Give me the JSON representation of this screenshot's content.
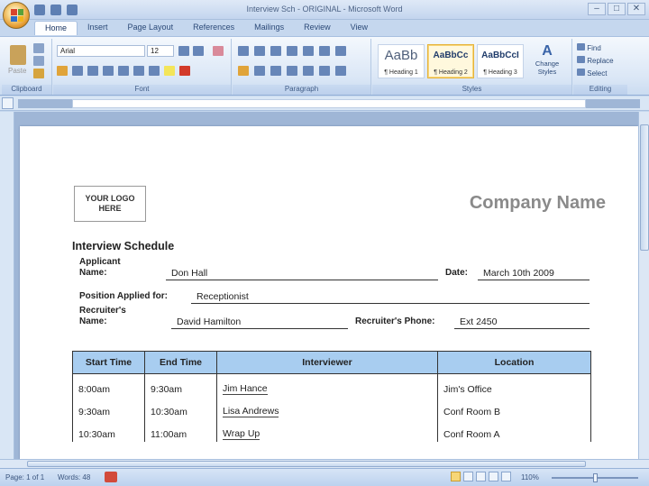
{
  "window": {
    "title": "Interview Sch - ORIGINAL - Microsoft Word"
  },
  "ribbon_tabs": [
    "Home",
    "Insert",
    "Page Layout",
    "References",
    "Mailings",
    "Review",
    "View"
  ],
  "ribbon": {
    "clipboard": {
      "label": "Clipboard",
      "paste_label": "Paste"
    },
    "font": {
      "label": "Font",
      "font_name": "Arial",
      "font_size": "12"
    },
    "paragraph": {
      "label": "Paragraph"
    },
    "styles": {
      "label": "Styles",
      "items": [
        {
          "preview": "AaBb",
          "name": "¶ Heading 1"
        },
        {
          "preview": "AaBbCc",
          "name": "¶ Heading 2"
        },
        {
          "preview": "AaBbCcI",
          "name": "¶ Heading 3"
        }
      ],
      "change_styles_label": "Change Styles"
    },
    "editing": {
      "label": "Editing",
      "find": "Find",
      "replace": "Replace",
      "select": "Select"
    }
  },
  "document": {
    "logo_text_1": "YOUR LOGO",
    "logo_text_2": "HERE",
    "company_name": "Company Name",
    "title": "Interview Schedule",
    "fields": {
      "applicant_label_1": "Applicant",
      "applicant_label_2": "Name:",
      "applicant_value": "Don Hall",
      "date_label": "Date:",
      "date_value": "March 10th 2009",
      "position_label": "Position Applied for:",
      "position_value": "Receptionist",
      "recruiter_label_1": "Recruiter's",
      "recruiter_label_2": "Name:",
      "recruiter_value": "David Hamilton",
      "recruiter_phone_label": "Recruiter's Phone:",
      "recruiter_phone_value": "Ext 2450"
    },
    "table": {
      "headers": [
        "Start Time",
        "End Time",
        "Interviewer",
        "Location"
      ],
      "rows": [
        [
          "8:00am",
          "9:30am",
          "Jim Hance",
          "Jim's Office"
        ],
        [
          "9:30am",
          "10:30am",
          "Lisa Andrews",
          "Conf Room B"
        ],
        [
          "10:30am",
          "11:00am",
          "Wrap Up",
          "Conf Room A"
        ]
      ]
    }
  },
  "status_bar": {
    "page": "Page: 1 of 1",
    "words": "Words: 48",
    "zoom": "110%"
  }
}
